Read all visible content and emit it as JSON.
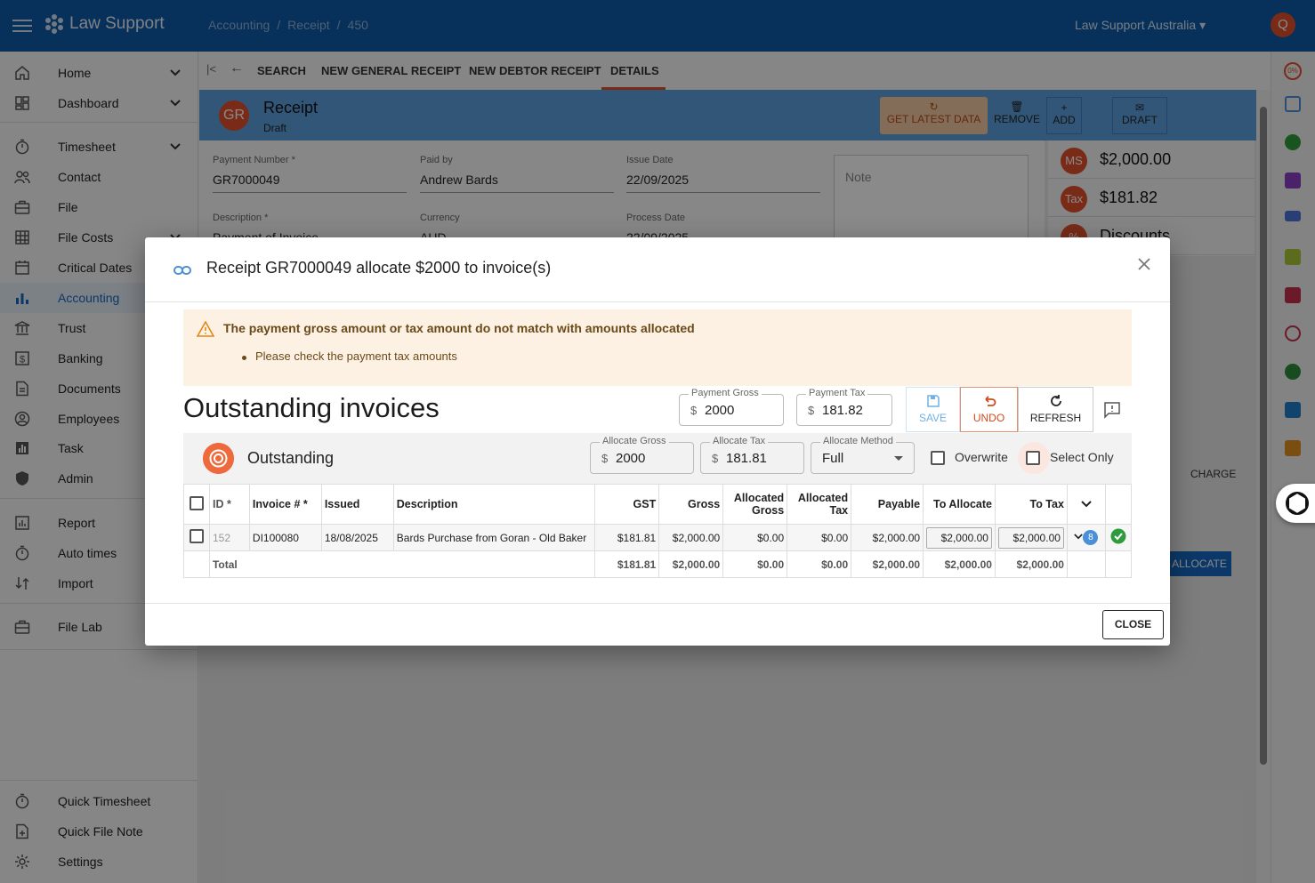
{
  "app": {
    "brand": "Law Support",
    "breadcrumbs": [
      "Accounting",
      "/",
      "Receipt",
      "/",
      "450"
    ],
    "org": "Law Support Australia",
    "user_initial": "Q"
  },
  "sidebar": {
    "items": [
      {
        "label": "Home",
        "icon": "home-icon"
      },
      {
        "label": "Dashboard",
        "icon": "dashboard-icon"
      },
      {
        "label": "Timesheet",
        "icon": "timer-icon"
      },
      {
        "label": "Contact",
        "icon": "people-icon"
      },
      {
        "label": "File",
        "icon": "briefcase-icon"
      },
      {
        "label": "File Costs",
        "icon": "file-costs-icon"
      },
      {
        "label": "Critical Dates",
        "icon": "calendar-icon"
      },
      {
        "label": "Accounting",
        "icon": "bar-chart-icon"
      },
      {
        "label": "Trust",
        "icon": "bank-icon"
      },
      {
        "label": "Banking",
        "icon": "dollar-icon"
      },
      {
        "label": "Documents",
        "icon": "document-icon"
      },
      {
        "label": "Employees",
        "icon": "employee-icon"
      },
      {
        "label": "Task",
        "icon": "task-icon"
      },
      {
        "label": "Admin",
        "icon": "shield-icon"
      },
      {
        "label": "Report",
        "icon": "report-icon"
      },
      {
        "label": "Auto times",
        "icon": "timer-icon"
      },
      {
        "label": "Import",
        "icon": "import-icon"
      },
      {
        "label": "File Lab",
        "icon": "briefcase-icon"
      },
      {
        "label": "Quick Timesheet",
        "icon": "timer-icon"
      },
      {
        "label": "Quick File Note",
        "icon": "note-add-icon"
      },
      {
        "label": "Settings",
        "icon": "gear-icon"
      }
    ]
  },
  "tabs": [
    "SEARCH",
    "NEW GENERAL RECEIPT",
    "NEW DEBTOR RECEIPT",
    "DETAILS"
  ],
  "receipt": {
    "avatar": "GR",
    "title": "Receipt",
    "status": "Draft",
    "buttons": {
      "get_latest": "GET LATEST DATA",
      "remove": "REMOVE",
      "add": "ADD",
      "draft": "DRAFT",
      "charge": "CHARGE",
      "allocate": "ALLOCATE"
    },
    "fields": {
      "payment_number_label": "Payment Number *",
      "payment_number": "GR7000049",
      "paid_by_label": "Paid by",
      "paid_by": "Andrew Bards",
      "issue_date_label": "Issue Date",
      "issue_date": "22/09/2025",
      "description_label": "Description *",
      "description": "Payment of Invoice",
      "currency_label": "Currency",
      "currency": "AUD",
      "process_date_label": "Process Date",
      "process_date": "22/09/2025",
      "note_placeholder": "Note"
    },
    "summary": [
      {
        "badge": "MS",
        "amount": "$2,000.00"
      },
      {
        "badge": "Tax",
        "amount": "$181.82"
      },
      {
        "badge": "%",
        "amount": "Discounts"
      }
    ]
  },
  "rail": {
    "percent": "0%"
  },
  "modal": {
    "title": "Receipt GR7000049 allocate $2000 to invoice(s)",
    "warning_title": "The payment gross amount or tax amount do not match with amounts allocated",
    "warning_items": [
      "Please check the payment tax amounts"
    ],
    "heading": "Outstanding invoices",
    "payment_gross_label": "Payment Gross",
    "payment_gross": "2000",
    "payment_tax_label": "Payment Tax",
    "payment_tax": "181.82",
    "currency_symbol": "$",
    "save_label": "SAVE",
    "undo_label": "UNDO",
    "refresh_label": "REFRESH",
    "panel_title": "Outstanding",
    "allocate_gross_label": "Allocate Gross",
    "allocate_gross": "2000",
    "allocate_tax_label": "Allocate Tax",
    "allocate_tax": "181.81",
    "allocate_method_label": "Allocate Method",
    "allocate_method": "Full",
    "overwrite_label": "Overwrite",
    "select_only_label": "Select Only",
    "columns": [
      "ID *",
      "Invoice # *",
      "Issued",
      "Description",
      "GST",
      "Gross",
      "Allocated Gross",
      "Allocated Tax",
      "Payable",
      "To Allocate",
      "To Tax"
    ],
    "rows": [
      {
        "id": "152",
        "invoice": "DI100080",
        "issued": "18/08/2025",
        "description": "Bards Purchase from Goran - Old Baker",
        "gst": "$181.81",
        "gross": "$2,000.00",
        "allocated_gross": "$0.00",
        "allocated_tax": "$0.00",
        "payable": "$2,000.00",
        "to_allocate": "$2,000.00",
        "to_tax": "$2,000.00",
        "badge": "8"
      }
    ],
    "total": {
      "label": "Total",
      "gst": "$181.81",
      "gross": "$2,000.00",
      "allocated_gross": "$0.00",
      "allocated_tax": "$0.00",
      "payable": "$2,000.00",
      "to_allocate": "$2,000.00",
      "to_tax": "$2,000.00"
    },
    "close_label": "CLOSE"
  },
  "colors": {
    "primary": "#0e5aa7",
    "accent": "#e0502e",
    "warning_bg": "#fdf1e4"
  }
}
